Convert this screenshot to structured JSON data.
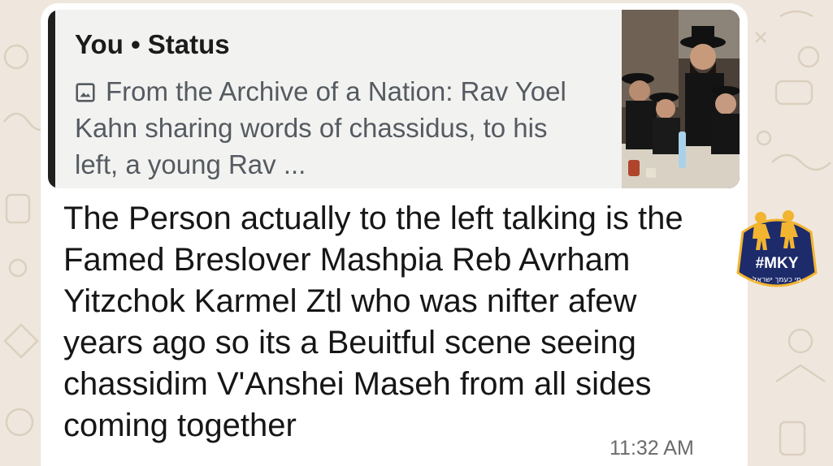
{
  "quoted_status": {
    "author": "You",
    "separator": "•",
    "label": "Status",
    "media_icon": "image-icon",
    "caption": "From the Archive of a Nation: Rav Yoel Kahn sharing words of chassidus, to his left, a young Rav ...",
    "thumbnail": "photo-thumbnail"
  },
  "message": {
    "text": "The Person actually to the left talking is the Famed Breslover Mashpia Reb Avrham Yitzchok Karmel Ztl who was nifter afew years ago so its a Beuitful scene seeing chassidim V'Anshei Maseh from all sides coming together",
    "time": "11:32 AM"
  },
  "logo": {
    "hashtag": "#MKY",
    "tagline": "מי כעמך ישראל"
  },
  "colors": {
    "wallpaper": "#efe7dd",
    "bubble": "#ffffff",
    "quote_background": "#f2f2f1",
    "quote_bar": "#1f1f1f",
    "logo_navy": "#1d2b6b",
    "logo_gold": "#f2b431"
  }
}
